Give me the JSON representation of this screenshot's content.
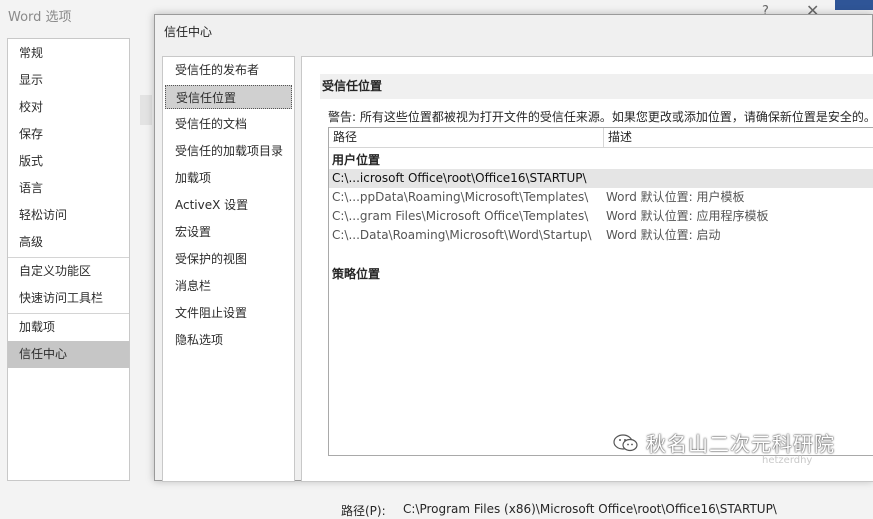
{
  "word_options": {
    "title": "Word 选项",
    "help_icon": "?",
    "close_icon": "✕",
    "nav": [
      "常规",
      "显示",
      "校对",
      "保存",
      "版式",
      "语言",
      "轻松访问",
      "高级",
      "自定义功能区",
      "快速访问工具栏",
      "加载项",
      "信任中心"
    ],
    "active_nav": "信任中心"
  },
  "trust_center": {
    "title": "信任中心",
    "nav": [
      "受信任的发布者",
      "受信任位置",
      "受信任的文档",
      "受信任的加载项目录",
      "加载项",
      "ActiveX 设置",
      "宏设置",
      "受保护的视图",
      "消息栏",
      "文件阻止设置",
      "隐私选项"
    ],
    "active_nav": "受信任位置",
    "section_heading": "受信任位置",
    "warning": "警告: 所有这些位置都被视为打开文件的受信任来源。如果您更改或添加位置，请确保新位置是安全的。",
    "table": {
      "columns": [
        "路径",
        "描述"
      ],
      "user_group": "用户位置",
      "rows": [
        {
          "path": "C:\\...icrosoft Office\\root\\Office16\\STARTUP\\",
          "desc": ""
        },
        {
          "path": "C:\\...ppData\\Roaming\\Microsoft\\Templates\\",
          "desc": "Word 默认位置: 用户模板"
        },
        {
          "path": "C:\\...gram Files\\Microsoft Office\\Templates\\",
          "desc": "Word 默认位置: 应用程序模板"
        },
        {
          "path": "C:\\...Data\\Roaming\\Microsoft\\Word\\Startup\\",
          "desc": "Word 默认位置: 启动"
        }
      ],
      "policy_group": "策略位置"
    },
    "path_label": "路径(P):",
    "path_value": "C:\\Program Files (x86)\\Microsoft Office\\root\\Office16\\STARTUP\\"
  },
  "watermark": {
    "text": "秋名山二次元科研院",
    "subtext": "hetzerdhy"
  },
  "colors": {
    "accent": "#2f5597",
    "selected_row": "#e5e5e5",
    "active_nav": "#c6c6c6"
  }
}
